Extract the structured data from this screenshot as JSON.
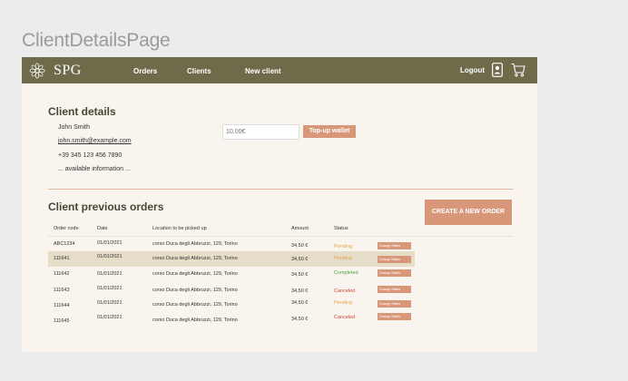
{
  "frame_title": "ClientDetailsPage",
  "navbar": {
    "brand": "SPG",
    "links": {
      "orders": "Orders",
      "clients": "Clients",
      "new_client": "New client"
    },
    "logout": "Logout"
  },
  "client_details": {
    "title": "Client details",
    "name": "John Smith",
    "email": "john.smith@example.com",
    "phone": "+39 345 123 456 7890",
    "more": "... available information ...",
    "wallet_placeholder": "10.00€",
    "topup_label": "Top-up wallet"
  },
  "orders": {
    "title": "Client previous orders",
    "create_label": "CREATE A NEW ORDER",
    "columns": {
      "code": "Order code",
      "date": "Date",
      "location": "Location to be picked up",
      "amount": "Amount",
      "status": "Status"
    },
    "change_status_label": "Change Status",
    "rows": [
      {
        "code": "ABC1234",
        "date": "01/01/2021",
        "location": "corso Duca degli Abbruzzi, 129, Torino",
        "amount": "34,50 €",
        "status": "Pending"
      },
      {
        "code": "111641",
        "date": "01/01/2021",
        "location": "corso Duca degli Abbruzzi, 129, Torino",
        "amount": "34,50 €",
        "status": "Pending"
      },
      {
        "code": "111642",
        "date": "01/01/2021",
        "location": "corso Duca degli Abbruzzi, 129, Torino",
        "amount": "34,50 €",
        "status": "Completed"
      },
      {
        "code": "111643",
        "date": "01/01/2021",
        "location": "corso Duca degli Abbruzzi, 129, Torino",
        "amount": "34,50 €",
        "status": "Canceled"
      },
      {
        "code": "111644",
        "date": "01/01/2021",
        "location": "corso Duca degli Abbruzzi, 129, Torino",
        "amount": "34,50 €",
        "status": "Pending"
      },
      {
        "code": "111645",
        "date": "01/01/2021",
        "location": "corso Duca degli Abbruzzi, 129, Torino",
        "amount": "34,50 €",
        "status": "Canceled"
      }
    ]
  },
  "colors": {
    "navbar": "#6e6a4a",
    "accent": "#d9977a",
    "page_bg": "#f9f4ed",
    "highlight_row": "#e5ddc8"
  },
  "icons": [
    "logo-icon",
    "user-icon",
    "cart-icon"
  ]
}
